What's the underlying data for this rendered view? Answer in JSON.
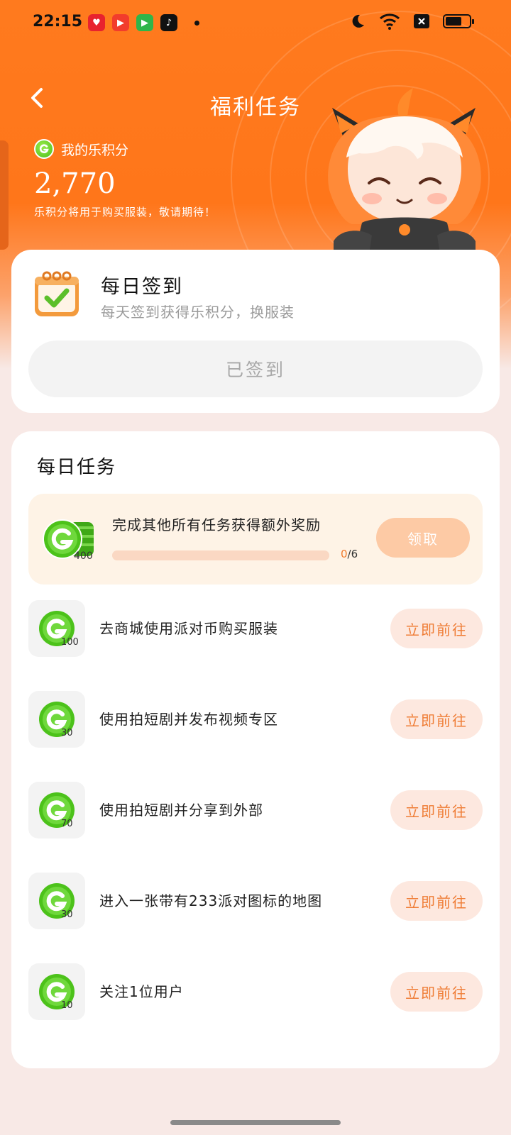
{
  "status_bar": {
    "time": "22:15",
    "app_icons": [
      "heart-app-icon",
      "video-app-icon",
      "game-app-icon",
      "tiktok-icon"
    ],
    "system_icons": [
      "moon-icon",
      "wifi-icon",
      "sim-off-icon",
      "battery-icon"
    ]
  },
  "header": {
    "title": "福利任务",
    "back_icon": "chevron-left-icon"
  },
  "points": {
    "label": "我的乐积分",
    "value": "2,770",
    "note": "乐积分将用于购买服装，敬请期待！"
  },
  "checkin": {
    "title": "每日签到",
    "subtitle": "每天签到获得乐积分，换服装",
    "button_label": "已签到"
  },
  "daily_tasks": {
    "title": "每日任务",
    "bonus": {
      "amount": "400",
      "text": "完成其他所有任务获得额外奖励",
      "progress_done": "0",
      "progress_total": "/6",
      "progress_fraction": 0,
      "button_label": "领取"
    },
    "items": [
      {
        "amount": "100",
        "text": "去商城使用派对币购买服装",
        "button_label": "立即前往"
      },
      {
        "amount": "30",
        "text": "使用拍短剧并发布视频专区",
        "button_label": "立即前往"
      },
      {
        "amount": "70",
        "text": "使用拍短剧并分享到外部",
        "button_label": "立即前往"
      },
      {
        "amount": "30",
        "text": "进入一张带有233派对图标的地图",
        "button_label": "立即前往"
      },
      {
        "amount": "10",
        "text": "关注1位用户",
        "button_label": "立即前往"
      }
    ]
  },
  "colors": {
    "header_orange": "#ff761a",
    "coin_green": "#4cc21a",
    "go_button_text": "#ef7d36",
    "go_button_bg": "#fde8df",
    "claim_button_bg": "#fdcaa5"
  }
}
